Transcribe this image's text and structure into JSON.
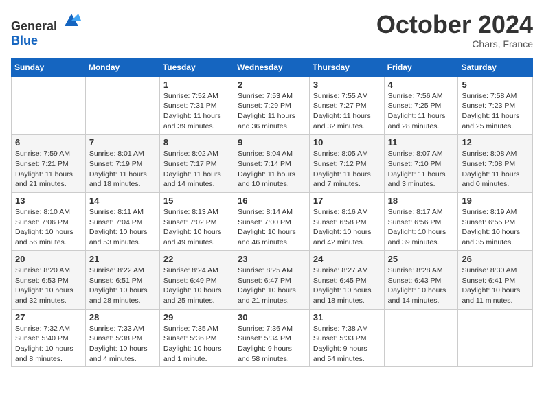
{
  "header": {
    "logo": {
      "text_general": "General",
      "text_blue": "Blue"
    },
    "title": "October 2024",
    "location": "Chars, France"
  },
  "calendar": {
    "weekdays": [
      "Sunday",
      "Monday",
      "Tuesday",
      "Wednesday",
      "Thursday",
      "Friday",
      "Saturday"
    ],
    "weeks": [
      [
        {
          "day": "",
          "sunrise": "",
          "sunset": "",
          "daylight": ""
        },
        {
          "day": "",
          "sunrise": "",
          "sunset": "",
          "daylight": ""
        },
        {
          "day": "1",
          "sunrise": "Sunrise: 7:52 AM",
          "sunset": "Sunset: 7:31 PM",
          "daylight": "Daylight: 11 hours and 39 minutes."
        },
        {
          "day": "2",
          "sunrise": "Sunrise: 7:53 AM",
          "sunset": "Sunset: 7:29 PM",
          "daylight": "Daylight: 11 hours and 36 minutes."
        },
        {
          "day": "3",
          "sunrise": "Sunrise: 7:55 AM",
          "sunset": "Sunset: 7:27 PM",
          "daylight": "Daylight: 11 hours and 32 minutes."
        },
        {
          "day": "4",
          "sunrise": "Sunrise: 7:56 AM",
          "sunset": "Sunset: 7:25 PM",
          "daylight": "Daylight: 11 hours and 28 minutes."
        },
        {
          "day": "5",
          "sunrise": "Sunrise: 7:58 AM",
          "sunset": "Sunset: 7:23 PM",
          "daylight": "Daylight: 11 hours and 25 minutes."
        }
      ],
      [
        {
          "day": "6",
          "sunrise": "Sunrise: 7:59 AM",
          "sunset": "Sunset: 7:21 PM",
          "daylight": "Daylight: 11 hours and 21 minutes."
        },
        {
          "day": "7",
          "sunrise": "Sunrise: 8:01 AM",
          "sunset": "Sunset: 7:19 PM",
          "daylight": "Daylight: 11 hours and 18 minutes."
        },
        {
          "day": "8",
          "sunrise": "Sunrise: 8:02 AM",
          "sunset": "Sunset: 7:17 PM",
          "daylight": "Daylight: 11 hours and 14 minutes."
        },
        {
          "day": "9",
          "sunrise": "Sunrise: 8:04 AM",
          "sunset": "Sunset: 7:14 PM",
          "daylight": "Daylight: 11 hours and 10 minutes."
        },
        {
          "day": "10",
          "sunrise": "Sunrise: 8:05 AM",
          "sunset": "Sunset: 7:12 PM",
          "daylight": "Daylight: 11 hours and 7 minutes."
        },
        {
          "day": "11",
          "sunrise": "Sunrise: 8:07 AM",
          "sunset": "Sunset: 7:10 PM",
          "daylight": "Daylight: 11 hours and 3 minutes."
        },
        {
          "day": "12",
          "sunrise": "Sunrise: 8:08 AM",
          "sunset": "Sunset: 7:08 PM",
          "daylight": "Daylight: 11 hours and 0 minutes."
        }
      ],
      [
        {
          "day": "13",
          "sunrise": "Sunrise: 8:10 AM",
          "sunset": "Sunset: 7:06 PM",
          "daylight": "Daylight: 10 hours and 56 minutes."
        },
        {
          "day": "14",
          "sunrise": "Sunrise: 8:11 AM",
          "sunset": "Sunset: 7:04 PM",
          "daylight": "Daylight: 10 hours and 53 minutes."
        },
        {
          "day": "15",
          "sunrise": "Sunrise: 8:13 AM",
          "sunset": "Sunset: 7:02 PM",
          "daylight": "Daylight: 10 hours and 49 minutes."
        },
        {
          "day": "16",
          "sunrise": "Sunrise: 8:14 AM",
          "sunset": "Sunset: 7:00 PM",
          "daylight": "Daylight: 10 hours and 46 minutes."
        },
        {
          "day": "17",
          "sunrise": "Sunrise: 8:16 AM",
          "sunset": "Sunset: 6:58 PM",
          "daylight": "Daylight: 10 hours and 42 minutes."
        },
        {
          "day": "18",
          "sunrise": "Sunrise: 8:17 AM",
          "sunset": "Sunset: 6:56 PM",
          "daylight": "Daylight: 10 hours and 39 minutes."
        },
        {
          "day": "19",
          "sunrise": "Sunrise: 8:19 AM",
          "sunset": "Sunset: 6:55 PM",
          "daylight": "Daylight: 10 hours and 35 minutes."
        }
      ],
      [
        {
          "day": "20",
          "sunrise": "Sunrise: 8:20 AM",
          "sunset": "Sunset: 6:53 PM",
          "daylight": "Daylight: 10 hours and 32 minutes."
        },
        {
          "day": "21",
          "sunrise": "Sunrise: 8:22 AM",
          "sunset": "Sunset: 6:51 PM",
          "daylight": "Daylight: 10 hours and 28 minutes."
        },
        {
          "day": "22",
          "sunrise": "Sunrise: 8:24 AM",
          "sunset": "Sunset: 6:49 PM",
          "daylight": "Daylight: 10 hours and 25 minutes."
        },
        {
          "day": "23",
          "sunrise": "Sunrise: 8:25 AM",
          "sunset": "Sunset: 6:47 PM",
          "daylight": "Daylight: 10 hours and 21 minutes."
        },
        {
          "day": "24",
          "sunrise": "Sunrise: 8:27 AM",
          "sunset": "Sunset: 6:45 PM",
          "daylight": "Daylight: 10 hours and 18 minutes."
        },
        {
          "day": "25",
          "sunrise": "Sunrise: 8:28 AM",
          "sunset": "Sunset: 6:43 PM",
          "daylight": "Daylight: 10 hours and 14 minutes."
        },
        {
          "day": "26",
          "sunrise": "Sunrise: 8:30 AM",
          "sunset": "Sunset: 6:41 PM",
          "daylight": "Daylight: 10 hours and 11 minutes."
        }
      ],
      [
        {
          "day": "27",
          "sunrise": "Sunrise: 7:32 AM",
          "sunset": "Sunset: 5:40 PM",
          "daylight": "Daylight: 10 hours and 8 minutes."
        },
        {
          "day": "28",
          "sunrise": "Sunrise: 7:33 AM",
          "sunset": "Sunset: 5:38 PM",
          "daylight": "Daylight: 10 hours and 4 minutes."
        },
        {
          "day": "29",
          "sunrise": "Sunrise: 7:35 AM",
          "sunset": "Sunset: 5:36 PM",
          "daylight": "Daylight: 10 hours and 1 minute."
        },
        {
          "day": "30",
          "sunrise": "Sunrise: 7:36 AM",
          "sunset": "Sunset: 5:34 PM",
          "daylight": "Daylight: 9 hours and 58 minutes."
        },
        {
          "day": "31",
          "sunrise": "Sunrise: 7:38 AM",
          "sunset": "Sunset: 5:33 PM",
          "daylight": "Daylight: 9 hours and 54 minutes."
        },
        {
          "day": "",
          "sunrise": "",
          "sunset": "",
          "daylight": ""
        },
        {
          "day": "",
          "sunrise": "",
          "sunset": "",
          "daylight": ""
        }
      ]
    ]
  }
}
